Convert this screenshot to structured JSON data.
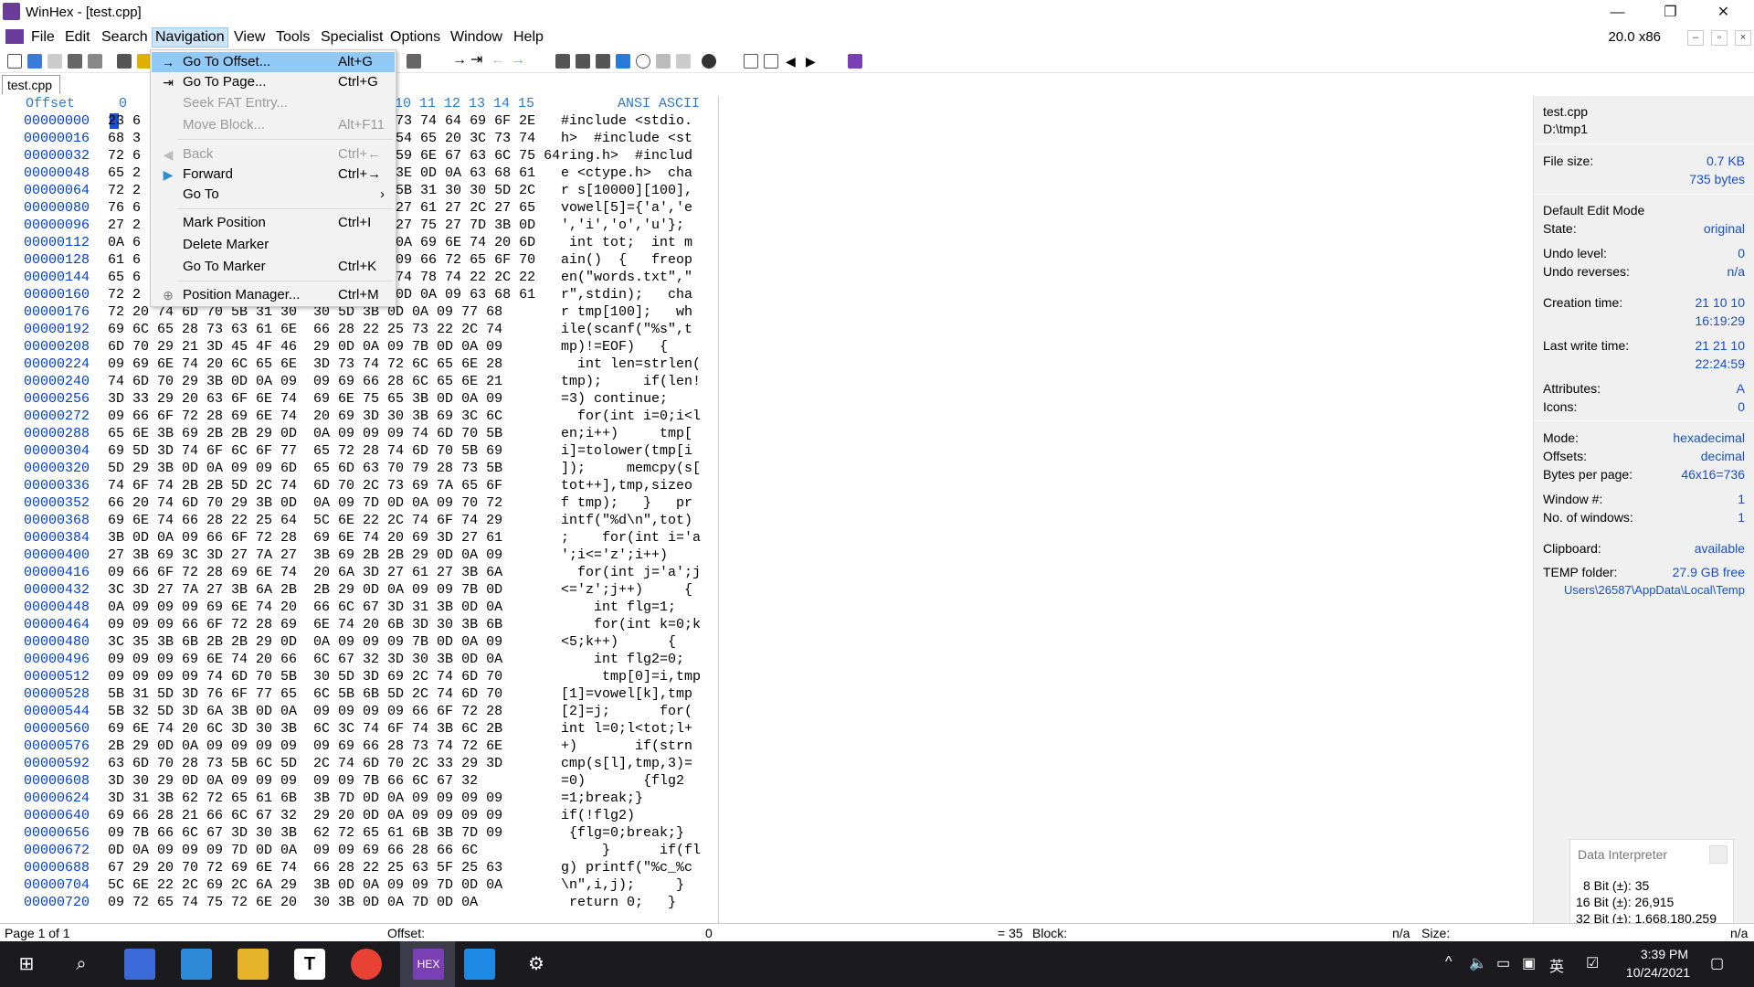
{
  "titlebar": {
    "title": "WinHex - [test.cpp]",
    "minimize": "—",
    "restore": "❐",
    "close": "✕"
  },
  "menubar": {
    "items": [
      "File",
      "Edit",
      "Search",
      "Navigation",
      "View",
      "Tools",
      "Specialist",
      "Options",
      "Window",
      "Help"
    ],
    "version": "20.0 x86",
    "mdi_min": "–",
    "mdi_restore": "▫",
    "mdi_close": "×"
  },
  "tab": {
    "label": "test.cpp"
  },
  "hex_header": {
    "offset": "Offset",
    "cols": "0",
    "cols_visible": "10  11  12  13  14  15",
    "ansi": "ANSI ASCII"
  },
  "hex": {
    "offsets": [
      "00000000",
      "00000016",
      "00000032",
      "00000048",
      "00000064",
      "00000080",
      "00000096",
      "00000112",
      "00000128",
      "00000144",
      "00000160",
      "00000176",
      "00000192",
      "00000208",
      "00000224",
      "00000240",
      "00000256",
      "00000272",
      "00000288",
      "00000304",
      "00000320",
      "00000336",
      "00000352",
      "00000368",
      "00000384",
      "00000400",
      "00000416",
      "00000432",
      "00000448",
      "00000464",
      "00000480",
      "00000496",
      "00000512",
      "00000528",
      "00000544",
      "00000560",
      "00000576",
      "00000592",
      "00000608",
      "00000624",
      "00000640",
      "00000656",
      "00000672",
      "00000688",
      "00000704",
      "00000720"
    ],
    "bytes": [
      "23 6                               73 74 64 69 6F 2E",
      "68 3                               54 65 20 3C 73 74",
      "72 6                               59 6E 67 63 6C 75 64",
      "65 2                               3E 0D 0A 63 68 61",
      "72 2                               5B 31 30 30 5D 2C",
      "76 6                               27 61 27 2C 27 65",
      "27 2                               27 75 27 7D 3B 0D",
      "0A 6                               0A 69 6E 74 20 6D",
      "61 6                               09 66 72 65 6F 70",
      "65 6                               74 78 74 22 2C 22",
      "72 2                               0D 0A 09 63 68 61",
      "72 20 74 6D 70 5B 31 30  30 5D 3B 0D 0A 09 77 68",
      "69 6C 65 28 73 63 61 6E  66 28 22 25 73 22 2C 74",
      "6D 70 29 21 3D 45 4F 46  29 0D 0A 09 7B 0D 0A 09",
      "09 69 6E 74 20 6C 65 6E  3D 73 74 72 6C 65 6E 28",
      "74 6D 70 29 3B 0D 0A 09  09 69 66 28 6C 65 6E 21",
      "3D 33 29 20 63 6F 6E 74  69 6E 75 65 3B 0D 0A 09",
      "09 66 6F 72 28 69 6E 74  20 69 3D 30 3B 69 3C 6C",
      "65 6E 3B 69 2B 2B 29 0D  0A 09 09 09 74 6D 70 5B",
      "69 5D 3D 74 6F 6C 6F 77  65 72 28 74 6D 70 5B 69",
      "5D 29 3B 0D 0A 09 09 6D  65 6D 63 70 79 28 73 5B",
      "74 6F 74 2B 2B 5D 2C 74  6D 70 2C 73 69 7A 65 6F",
      "66 20 74 6D 70 29 3B 0D  0A 09 7D 0D 0A 09 70 72",
      "69 6E 74 66 28 22 25 64  5C 6E 22 2C 74 6F 74 29",
      "3B 0D 0A 09 66 6F 72 28  69 6E 74 20 69 3D 27 61",
      "27 3B 69 3C 3D 27 7A 27  3B 69 2B 2B 29 0D 0A 09",
      "09 66 6F 72 28 69 6E 74  20 6A 3D 27 61 27 3B 6A",
      "3C 3D 27 7A 27 3B 6A 2B  2B 29 0D 0A 09 09 7B 0D",
      "0A 09 09 09 69 6E 74 20  66 6C 67 3D 31 3B 0D 0A",
      "09 09 09 66 6F 72 28 69  6E 74 20 6B 3D 30 3B 6B",
      "3C 35 3B 6B 2B 2B 29 0D  0A 09 09 09 7B 0D 0A 09",
      "09 09 09 69 6E 74 20 66  6C 67 32 3D 30 3B 0D 0A",
      "09 09 09 09 74 6D 70 5B  30 5D 3D 69 2C 74 6D 70",
      "5B 31 5D 3D 76 6F 77 65  6C 5B 6B 5D 2C 74 6D 70",
      "5B 32 5D 3D 6A 3B 0D 0A  09 09 09 09 66 6F 72 28",
      "69 6E 74 20 6C 3D 30 3B  6C 3C 74 6F 74 3B 6C 2B",
      "2B 29 0D 0A 09 09 09 09  09 69 66 28 73 74 72 6E",
      "63 6D 70 28 73 5B 6C 5D  2C 74 6D 70 2C 33 29 3D",
      "3D 30 29 0D 0A 09 09 09  09 09 7B 66 6C 67 32",
      "3D 31 3B 62 72 65 61 6B  3B 7D 0D 0A 09 09 09 09",
      "69 66 28 21 66 6C 67 32  29 20 0D 0A 09 09 09 09",
      "09 7B 66 6C 67 3D 30 3B  62 72 65 61 6B 3B 7D 09",
      "0D 0A 09 09 09 7D 0D 0A  09 09 69 66 28 66 6C",
      "67 29 20 70 72 69 6E 74  66 28 22 25 63 5F 25 63",
      "5C 6E 22 2C 69 2C 6A 29  3B 0D 0A 09 09 7D 0D 0A",
      "09 72 65 74 75 72 6E 20  30 3B 0D 0A 7D 0D 0A"
    ],
    "ansi": [
      "#include <stdio.",
      "h>  #include <st",
      "ring.h>  #includ",
      "e <ctype.h>  cha",
      "r s[10000][100],",
      "vowel[5]={'a','e",
      "','i','o','u'};",
      " int tot;  int m",
      "ain()  {   freop",
      "en(\"words.txt\",\"",
      "r\",stdin);   cha",
      "r tmp[100];   wh",
      "ile(scanf(\"%s\",t",
      "mp)!=EOF)   {",
      "  int len=strlen(",
      "tmp);     if(len!",
      "=3) continue;",
      "  for(int i=0;i<l",
      "en;i++)     tmp[",
      "i]=tolower(tmp[i",
      "]);     memcpy(s[",
      "tot++],tmp,sizeo",
      "f tmp);   }   pr",
      "intf(\"%d\\n\",tot)",
      ";    for(int i='a",
      "';i<='z';i++)",
      "  for(int j='a';j",
      "<='z';j++)     {",
      "    int flg=1;",
      "    for(int k=0;k",
      "<5;k++)      {",
      "    int flg2=0;",
      "     tmp[0]=i,tmp",
      "[1]=vowel[k],tmp",
      "[2]=j;      for(",
      "int l=0;l<tot;l+",
      "+)       if(strn",
      "cmp(s[l],tmp,3)=",
      "=0)       {flg2",
      "=1;break;}",
      "if(!flg2)",
      " {flg=0;break;}",
      "     }      if(fl",
      "g) printf(\"%c_%c",
      "\\n\",i,j);     }",
      " return 0;   }"
    ]
  },
  "nav_menu": {
    "items": [
      {
        "label": "Go To Offset...",
        "shortcut": "Alt+G",
        "glyph": "→"
      },
      {
        "label": "Go To Page...",
        "shortcut": "Ctrl+G",
        "glyph": "⇥"
      },
      {
        "label": "Seek FAT Entry...",
        "shortcut": "",
        "glyph": ""
      },
      {
        "label": "Move Block...",
        "shortcut": "Alt+F11",
        "glyph": ""
      },
      {
        "label": "Back",
        "shortcut": "Ctrl+←",
        "glyph": "◀"
      },
      {
        "label": "Forward",
        "shortcut": "Ctrl+→",
        "glyph": "▶"
      },
      {
        "label": "Go To",
        "shortcut": "›",
        "glyph": ""
      },
      {
        "label": "Mark Position",
        "shortcut": "Ctrl+I",
        "glyph": ""
      },
      {
        "label": "Delete Marker",
        "shortcut": "",
        "glyph": ""
      },
      {
        "label": "Go To Marker",
        "shortcut": "Ctrl+K",
        "glyph": ""
      },
      {
        "label": "Position Manager...",
        "shortcut": "Ctrl+M",
        "glyph": "⊕"
      }
    ]
  },
  "info": {
    "filename": "test.cpp",
    "path": "D:\\tmp1",
    "file_size_label": "File size:",
    "file_size_kb": "0.7 KB",
    "file_size_bytes": "735 bytes",
    "edit_mode_label": "Default Edit Mode",
    "state_label": "State:",
    "state": "original",
    "undo_level_label": "Undo level:",
    "undo_level": "0",
    "undo_reverses_label": "Undo reverses:",
    "undo_reverses": "n/a",
    "creation_label": "Creation time:",
    "creation_date": "21 10 10",
    "creation_time": "16:19:29",
    "lastwrite_label": "Last write time:",
    "lastwrite_date": "21 21 10",
    "lastwrite_time": "22:24:59",
    "attributes_label": "Attributes:",
    "attributes": "A",
    "icons_label": "Icons:",
    "icons": "0",
    "mode_label": "Mode:",
    "mode": "hexadecimal",
    "offsets_label": "Offsets:",
    "offsets": "decimal",
    "bpp_label": "Bytes per page:",
    "bpp": "46x16=736",
    "window_label": "Window #:",
    "window": "1",
    "nwin_label": "No. of windows:",
    "nwin": "1",
    "clipboard_label": "Clipboard:",
    "clipboard": "available",
    "temp_label": "TEMP folder:",
    "temp_free": "27.9 GB free",
    "temp_path": "Users\\26587\\AppData\\Local\\Temp"
  },
  "data_interpreter": {
    "title": "Data Interpreter",
    "bit8": "8 Bit (±): 35",
    "bit16": "16 Bit (±): 26,915",
    "bit32": "32 Bit (±): 1,668,180,259"
  },
  "statusbar": {
    "page": "Page 1 of 1",
    "offset_label": "Offset:",
    "offset_value": "0",
    "value": "= 35",
    "block_label": "Block:",
    "block_value": "n/a",
    "size_label": "Size:",
    "size_value": "n/a"
  },
  "taskbar": {
    "time": "3:39 PM",
    "date": "10/24/2021",
    "ime": "英"
  }
}
